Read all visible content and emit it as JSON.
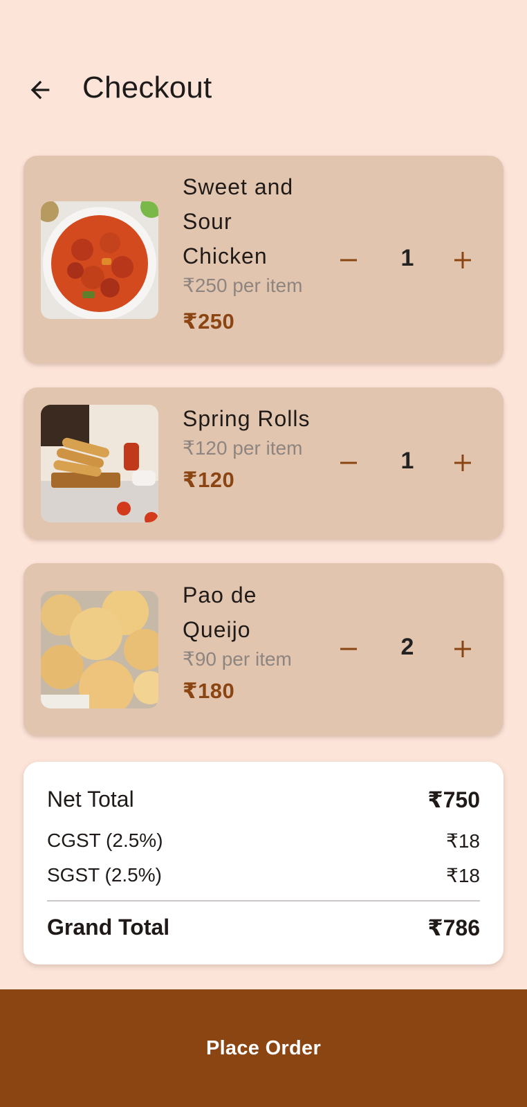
{
  "header": {
    "title": "Checkout",
    "back_icon": "arrow-left-icon"
  },
  "colors": {
    "background": "#FCE4D9",
    "card": "#E2C5AE",
    "accent": "#8B4513",
    "muted": "#8e8580"
  },
  "items": [
    {
      "name": "Sweet and Sour Chicken",
      "unit_price": "₹250 per item",
      "total": "₹250",
      "quantity": "1"
    },
    {
      "name": "Spring Rolls",
      "unit_price": "₹120 per item",
      "total": "₹120",
      "quantity": "1"
    },
    {
      "name": "Pao de Queijo",
      "unit_price": "₹90 per item",
      "total": "₹180",
      "quantity": "2"
    }
  ],
  "summary": {
    "net_label": "Net Total",
    "net_value": "₹750",
    "cgst_label": "CGST (2.5%)",
    "cgst_value": "₹18",
    "sgst_label": "SGST (2.5%)",
    "sgst_value": "₹18",
    "grand_label": "Grand Total",
    "grand_value": "₹786"
  },
  "actions": {
    "place_order": "Place Order"
  }
}
